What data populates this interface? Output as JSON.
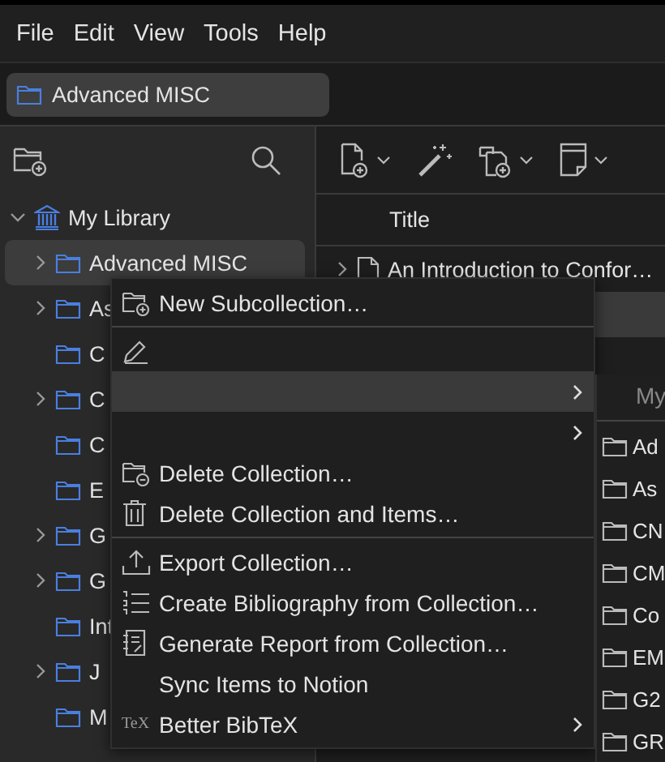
{
  "menu_bar": [
    {
      "label": "File"
    },
    {
      "label": "Edit"
    },
    {
      "label": "View"
    },
    {
      "label": "Tools"
    },
    {
      "label": "Help"
    }
  ],
  "tabs": [
    {
      "label": "Advanced MISC",
      "selected": true
    }
  ],
  "collections_pane": {
    "library": {
      "label": "My Library",
      "expanded": true,
      "children": [
        {
          "label": "Advanced MISC",
          "expandable": true,
          "selected": true
        },
        {
          "label": "As",
          "expandable": true,
          "selected": false
        },
        {
          "label": "C",
          "expandable": false,
          "selected": false
        },
        {
          "label": "C",
          "expandable": true,
          "selected": false
        },
        {
          "label": "C",
          "expandable": false,
          "selected": false
        },
        {
          "label": "E",
          "expandable": false,
          "selected": false
        },
        {
          "label": "G",
          "expandable": true,
          "selected": false
        },
        {
          "label": "G",
          "expandable": true,
          "selected": false
        },
        {
          "label": "Int",
          "expandable": false,
          "selected": false
        },
        {
          "label": "J",
          "expandable": true,
          "selected": false
        },
        {
          "label": "M",
          "expandable": false,
          "selected": false
        }
      ]
    }
  },
  "items_pane": {
    "columns": [
      "Title"
    ],
    "rows": [
      {
        "title": "An Introduction to Confor…",
        "selected": false
      },
      {
        "selected": true
      }
    ]
  },
  "context_menu": [
    {
      "kind": "item",
      "label": "New Subcollection…",
      "selected": false,
      "submenu": false
    },
    {
      "kind": "separator"
    },
    {
      "kind": "item",
      "selected": false,
      "submenu": false
    },
    {
      "kind": "item",
      "selected": true,
      "submenu": true
    },
    {
      "kind": "item",
      "selected": false,
      "submenu": true
    },
    {
      "kind": "item",
      "label": "Delete Collection…",
      "selected": false,
      "submenu": false
    },
    {
      "kind": "item",
      "label": "Delete Collection and Items…",
      "selected": false,
      "submenu": false
    },
    {
      "kind": "separator"
    },
    {
      "kind": "item",
      "label": "Export Collection…",
      "selected": false,
      "submenu": false
    },
    {
      "kind": "item",
      "label": "Create Bibliography from Collection…",
      "selected": false,
      "submenu": false
    },
    {
      "kind": "item",
      "label": "Generate Report from Collection…",
      "selected": false,
      "submenu": false
    },
    {
      "kind": "item",
      "label": "Sync Items to Notion",
      "selected": false,
      "submenu": false
    },
    {
      "kind": "item",
      "label": "Better BibTeX",
      "icon_text": "TeX",
      "selected": false,
      "submenu": true
    }
  ],
  "submenu": {
    "header": {
      "label": "My",
      "disabled": true
    },
    "items": [
      {
        "label": "Ad"
      },
      {
        "label": "As"
      },
      {
        "label": "CN"
      },
      {
        "label": "CM"
      },
      {
        "label": "Co"
      },
      {
        "label": "EM"
      },
      {
        "label": "G2"
      },
      {
        "label": "GR"
      }
    ]
  }
}
